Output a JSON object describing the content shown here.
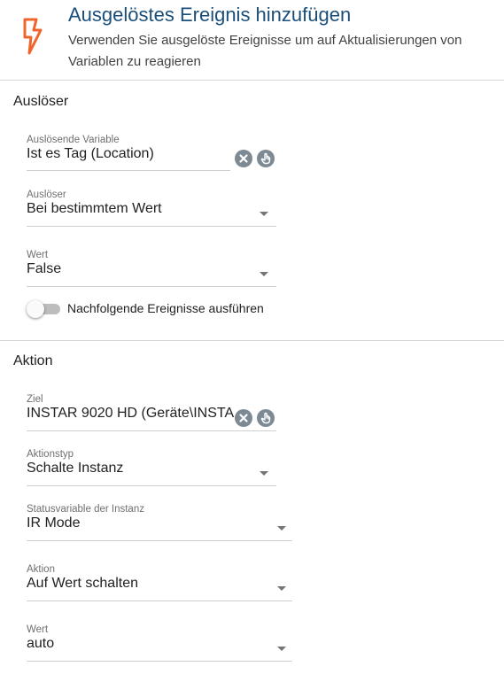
{
  "header": {
    "icon": "lightning-bolt-icon",
    "title": "Ausgelöstes Ereignis hinzufügen",
    "subtitle": "Verwenden Sie ausgelöste Ereignisse um auf Aktualisierungen von Variablen zu reagieren"
  },
  "trigger_section": {
    "title": "Auslöser",
    "variable": {
      "label": "Auslösende Variable",
      "value": "Ist es Tag (Location)"
    },
    "trigger": {
      "label": "Auslöser",
      "value": "Bei bestimmtem Wert"
    },
    "value": {
      "label": "Wert",
      "value": "False"
    },
    "subsequent": {
      "label": "Nachfolgende Ereignisse ausführen",
      "checked": false
    }
  },
  "action_section": {
    "title": "Aktion",
    "target": {
      "label": "Ziel",
      "value": "INSTAR 9020 HD (Geräte\\INSTAR"
    },
    "action_type": {
      "label": "Aktionstyp",
      "value": "Schalte Instanz"
    },
    "status_variable": {
      "label": "Statusvariable der Instanz",
      "value": "IR Mode"
    },
    "action": {
      "label": "Aktion",
      "value": "Auf Wert schalten"
    },
    "value": {
      "label": "Wert",
      "value": "auto"
    }
  },
  "colors": {
    "accent_orange": "#f0642d",
    "title_blue": "#1b4f7a",
    "icon_grey": "#7d8a94"
  }
}
